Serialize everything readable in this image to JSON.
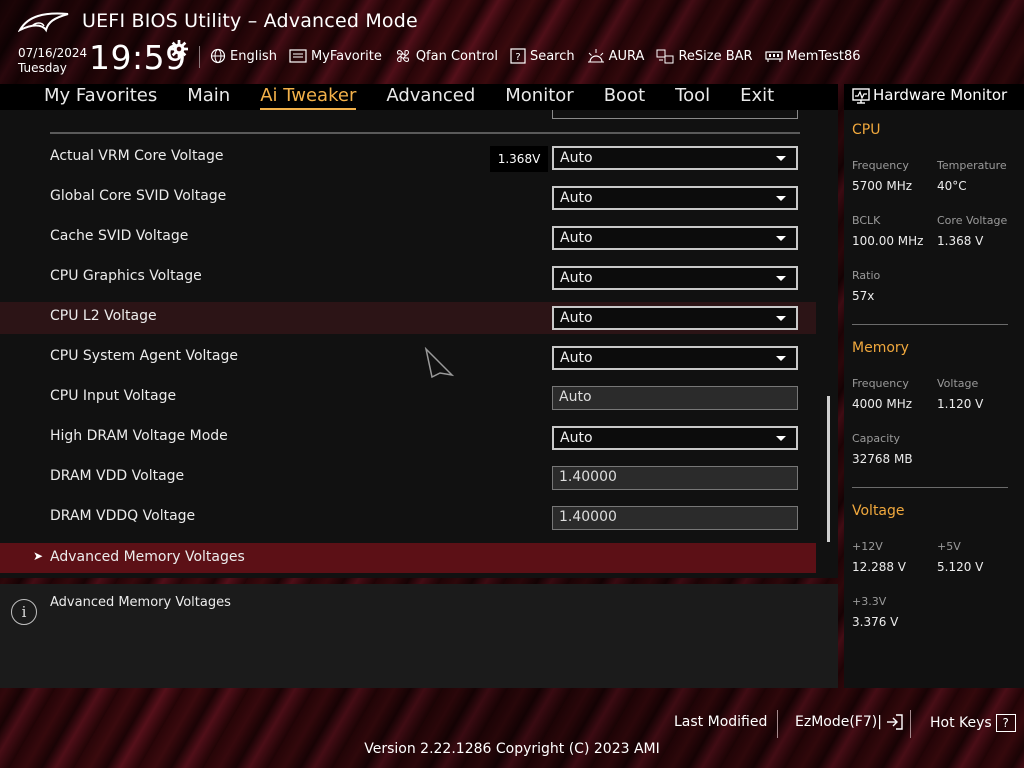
{
  "header": {
    "title": "UEFI BIOS Utility – Advanced Mode",
    "date": "07/16/2024",
    "day": "Tuesday",
    "time": "19:59",
    "toolbar": [
      {
        "label": "English",
        "icon": "globe-icon"
      },
      {
        "label": "MyFavorite",
        "icon": "favorite-icon"
      },
      {
        "label": "Qfan Control",
        "icon": "fan-icon"
      },
      {
        "label": "Search",
        "icon": "search-help-icon"
      },
      {
        "label": "AURA",
        "icon": "aura-icon"
      },
      {
        "label": "ReSize BAR",
        "icon": "resize-bar-icon"
      },
      {
        "label": "MemTest86",
        "icon": "memtest-icon"
      }
    ]
  },
  "nav": {
    "tabs": [
      "My Favorites",
      "Main",
      "Ai Tweaker",
      "Advanced",
      "Monitor",
      "Boot",
      "Tool",
      "Exit"
    ],
    "active": "Ai Tweaker"
  },
  "settings": {
    "vrm_readout": "1.368V",
    "rows": [
      {
        "label": "Actual VRM Core Voltage",
        "value": "Auto",
        "type": "dropdown"
      },
      {
        "label": "Global Core SVID Voltage",
        "value": "Auto",
        "type": "dropdown"
      },
      {
        "label": "Cache SVID Voltage",
        "value": "Auto",
        "type": "dropdown"
      },
      {
        "label": "CPU Graphics Voltage",
        "value": "Auto",
        "type": "dropdown"
      },
      {
        "label": "CPU L2 Voltage",
        "value": "Auto",
        "type": "dropdown"
      },
      {
        "label": "CPU System Agent Voltage",
        "value": "Auto",
        "type": "dropdown"
      },
      {
        "label": "CPU Input Voltage",
        "value": "Auto",
        "type": "readonly"
      },
      {
        "label": "High DRAM Voltage Mode",
        "value": "Auto",
        "type": "dropdown"
      },
      {
        "label": "DRAM VDD Voltage",
        "value": "1.40000",
        "type": "text"
      },
      {
        "label": "DRAM VDDQ Voltage",
        "value": "1.40000",
        "type": "text"
      }
    ],
    "submenu": "Advanced Memory Voltages"
  },
  "help": {
    "text": "Advanced Memory Voltages"
  },
  "hardware_monitor": {
    "title": "Hardware Monitor",
    "cpu": {
      "heading": "CPU",
      "frequency_label": "Frequency",
      "frequency": "5700 MHz",
      "temperature_label": "Temperature",
      "temperature": "40°C",
      "bclk_label": "BCLK",
      "bclk": "100.00 MHz",
      "core_voltage_label": "Core Voltage",
      "core_voltage": "1.368 V",
      "ratio_label": "Ratio",
      "ratio": "57x"
    },
    "memory": {
      "heading": "Memory",
      "frequency_label": "Frequency",
      "frequency": "4000 MHz",
      "voltage_label": "Voltage",
      "voltage": "1.120 V",
      "capacity_label": "Capacity",
      "capacity": "32768 MB"
    },
    "voltage": {
      "heading": "Voltage",
      "v12_label": "+12V",
      "v12": "12.288 V",
      "v5_label": "+5V",
      "v5": "5.120 V",
      "v33_label": "+3.3V",
      "v33": "3.376 V"
    }
  },
  "footer": {
    "last_modified": "Last Modified",
    "ezmode": "EzMode(F7)|",
    "hot_keys": "Hot Keys",
    "hot_keys_key": "?",
    "version": "Version 2.22.1286 Copyright (C) 2023 AMI"
  },
  "colors": {
    "accent": "#f3b14a",
    "highlight_row": "#2c1416",
    "submenu_bg": "#5c1016"
  }
}
